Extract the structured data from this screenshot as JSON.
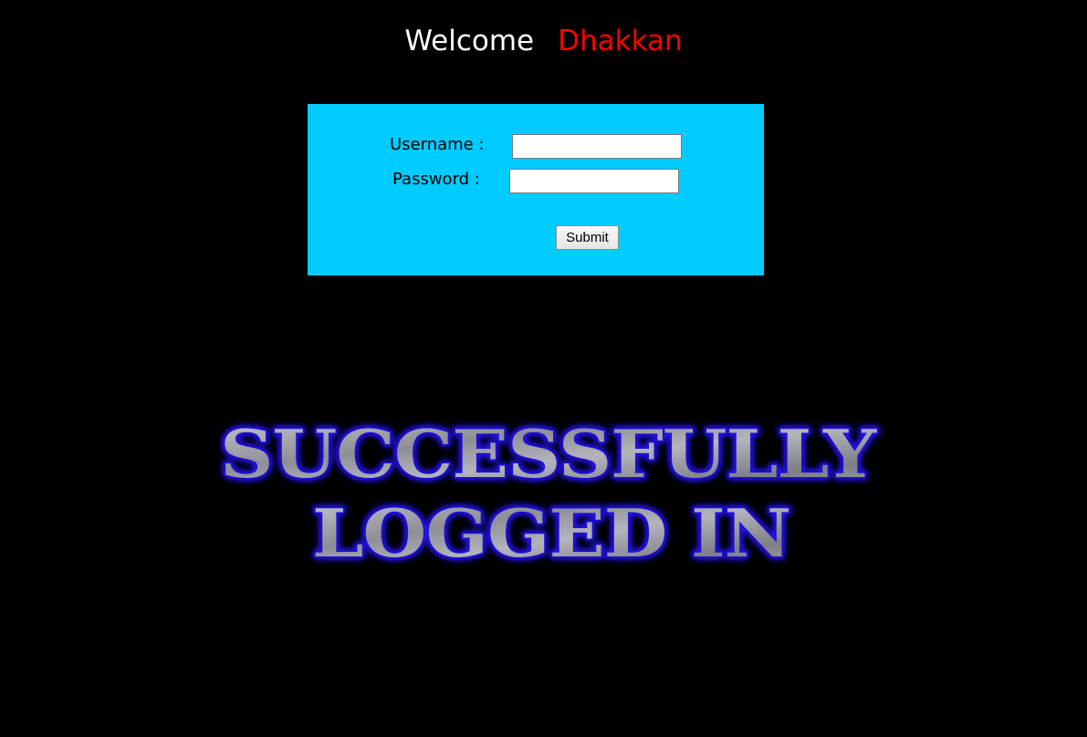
{
  "header": {
    "welcome_word": "Welcome",
    "welcome_name": "Dhakkan"
  },
  "login_form": {
    "username_label": "Username :",
    "username_value": "",
    "password_label": "Password :",
    "password_value": "",
    "submit_label": "Submit"
  },
  "result": {
    "line1": "SUCCESSFULLY",
    "line2": "LOGGED IN"
  },
  "colors": {
    "page_background": "#000000",
    "form_background": "#00ccff",
    "welcome_text": "#ffffff",
    "name_text": "#ff0000",
    "banner_glow": "#2a1bff",
    "banner_fill": "#9c9ca4"
  }
}
